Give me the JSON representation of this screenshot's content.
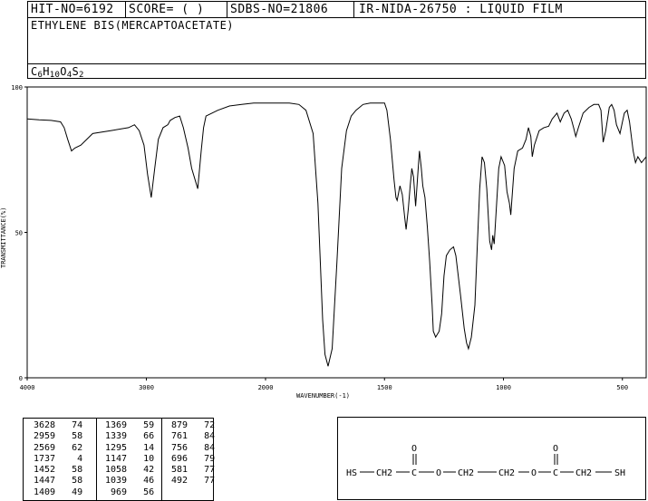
{
  "header": {
    "hit_no": "HIT-NO=6192",
    "score": "SCORE=  (   )",
    "sdbs_no": "SDBS-NO=21806",
    "ir_nida": "IR-NIDA-26750 : LIQUID FILM",
    "compound_name": "ETHYLENE BIS(MERCAPTOACETATE)",
    "formula": {
      "C": "6",
      "H": "10",
      "O": "4",
      "S": "2"
    }
  },
  "chart_data": {
    "type": "line",
    "title": "",
    "xlabel": "WAVENUMBER(-1)",
    "ylabel": "TRANSMITTANCE(%)",
    "xlim": [
      4000,
      400
    ],
    "ylim": [
      0,
      100
    ],
    "x_reversed": true,
    "x_ticks": [
      4000,
      3000,
      2000,
      1500,
      1000,
      500
    ],
    "y_ticks": [
      0,
      50,
      100
    ],
    "grid": false,
    "series": [
      {
        "name": "",
        "points": [
          [
            4000,
            89
          ],
          [
            3900,
            88.7
          ],
          [
            3800,
            88.5
          ],
          [
            3720,
            88
          ],
          [
            3690,
            86
          ],
          [
            3660,
            82
          ],
          [
            3628,
            78
          ],
          [
            3600,
            79
          ],
          [
            3550,
            80
          ],
          [
            3450,
            84
          ],
          [
            3300,
            85
          ],
          [
            3150,
            86
          ],
          [
            3100,
            87
          ],
          [
            3060,
            85
          ],
          [
            3020,
            80
          ],
          [
            2990,
            70
          ],
          [
            2959,
            62
          ],
          [
            2930,
            72
          ],
          [
            2900,
            82
          ],
          [
            2860,
            86
          ],
          [
            2820,
            87
          ],
          [
            2800,
            88.5
          ],
          [
            2760,
            89.5
          ],
          [
            2720,
            90
          ],
          [
            2690,
            86
          ],
          [
            2650,
            79
          ],
          [
            2620,
            72
          ],
          [
            2569,
            65
          ],
          [
            2540,
            78
          ],
          [
            2520,
            86
          ],
          [
            2500,
            90
          ],
          [
            2400,
            92
          ],
          [
            2300,
            93.5
          ],
          [
            2200,
            94
          ],
          [
            2100,
            94.5
          ],
          [
            2000,
            94.5
          ],
          [
            1900,
            94.5
          ],
          [
            1860,
            94
          ],
          [
            1830,
            92
          ],
          [
            1800,
            84
          ],
          [
            1780,
            60
          ],
          [
            1760,
            20
          ],
          [
            1750,
            8
          ],
          [
            1737,
            4
          ],
          [
            1720,
            10
          ],
          [
            1700,
            40
          ],
          [
            1680,
            72
          ],
          [
            1660,
            85
          ],
          [
            1640,
            90
          ],
          [
            1620,
            92
          ],
          [
            1590,
            94
          ],
          [
            1560,
            94.5
          ],
          [
            1520,
            94.5
          ],
          [
            1500,
            94.5
          ],
          [
            1490,
            92
          ],
          [
            1475,
            82
          ],
          [
            1460,
            68
          ],
          [
            1452,
            62
          ],
          [
            1447,
            61
          ],
          [
            1435,
            66
          ],
          [
            1425,
            63
          ],
          [
            1415,
            55
          ],
          [
            1409,
            51
          ],
          [
            1400,
            58
          ],
          [
            1392,
            66
          ],
          [
            1385,
            72
          ],
          [
            1378,
            69
          ],
          [
            1369,
            59
          ],
          [
            1360,
            70
          ],
          [
            1353,
            78
          ],
          [
            1345,
            72
          ],
          [
            1339,
            66
          ],
          [
            1330,
            62
          ],
          [
            1320,
            52
          ],
          [
            1310,
            40
          ],
          [
            1300,
            25
          ],
          [
            1295,
            16
          ],
          [
            1285,
            14
          ],
          [
            1270,
            16
          ],
          [
            1260,
            22
          ],
          [
            1250,
            35
          ],
          [
            1240,
            42
          ],
          [
            1225,
            44
          ],
          [
            1210,
            45
          ],
          [
            1200,
            42
          ],
          [
            1180,
            28
          ],
          [
            1165,
            17
          ],
          [
            1155,
            12
          ],
          [
            1147,
            10
          ],
          [
            1135,
            14
          ],
          [
            1120,
            25
          ],
          [
            1110,
            45
          ],
          [
            1100,
            65
          ],
          [
            1090,
            76
          ],
          [
            1080,
            74
          ],
          [
            1070,
            65
          ],
          [
            1058,
            47
          ],
          [
            1050,
            44
          ],
          [
            1045,
            49
          ],
          [
            1039,
            46
          ],
          [
            1030,
            58
          ],
          [
            1020,
            72
          ],
          [
            1010,
            76
          ],
          [
            995,
            73
          ],
          [
            985,
            64
          ],
          [
            975,
            60
          ],
          [
            969,
            56
          ],
          [
            955,
            72
          ],
          [
            940,
            78
          ],
          [
            920,
            79
          ],
          [
            905,
            82
          ],
          [
            895,
            86
          ],
          [
            885,
            83
          ],
          [
            879,
            76
          ],
          [
            870,
            80
          ],
          [
            850,
            85
          ],
          [
            830,
            86
          ],
          [
            810,
            86.5
          ],
          [
            795,
            89
          ],
          [
            775,
            91
          ],
          [
            761,
            88
          ],
          [
            745,
            91
          ],
          [
            730,
            92
          ],
          [
            715,
            89
          ],
          [
            705,
            86
          ],
          [
            696,
            83
          ],
          [
            685,
            86
          ],
          [
            665,
            91
          ],
          [
            640,
            93
          ],
          [
            620,
            94
          ],
          [
            600,
            94
          ],
          [
            590,
            92
          ],
          [
            581,
            81
          ],
          [
            570,
            85
          ],
          [
            555,
            93
          ],
          [
            545,
            94
          ],
          [
            535,
            92
          ],
          [
            525,
            87
          ],
          [
            510,
            84
          ],
          [
            500,
            88
          ],
          [
            492,
            91
          ],
          [
            480,
            92
          ],
          [
            470,
            88
          ],
          [
            455,
            78
          ],
          [
            445,
            74
          ],
          [
            435,
            76
          ],
          [
            420,
            74
          ],
          [
            410,
            75
          ],
          [
            400,
            76
          ]
        ]
      }
    ]
  },
  "peak_table": [
    [
      [
        "3628",
        "74"
      ],
      [
        "2959",
        "58"
      ],
      [
        "2569",
        "62"
      ],
      [
        "1737",
        "4"
      ],
      [
        "1452",
        "58"
      ],
      [
        "1447",
        "58"
      ],
      [
        "1409",
        "49"
      ]
    ],
    [
      [
        "1369",
        "59"
      ],
      [
        "1339",
        "66"
      ],
      [
        "1295",
        "14"
      ],
      [
        "1147",
        "10"
      ],
      [
        "1058",
        "42"
      ],
      [
        "1039",
        "46"
      ],
      [
        "969",
        "56"
      ]
    ],
    [
      [
        "879",
        "72"
      ],
      [
        "761",
        "84"
      ],
      [
        "756",
        "84"
      ],
      [
        "696",
        "79"
      ],
      [
        "581",
        "77"
      ],
      [
        "492",
        "77"
      ]
    ]
  ],
  "structure": {
    "labels": [
      "HS",
      "CH2",
      "C",
      "O",
      "CH2",
      "CH2",
      "O",
      "C",
      "CH2",
      "SH"
    ],
    "carbonyl_o": "O"
  }
}
